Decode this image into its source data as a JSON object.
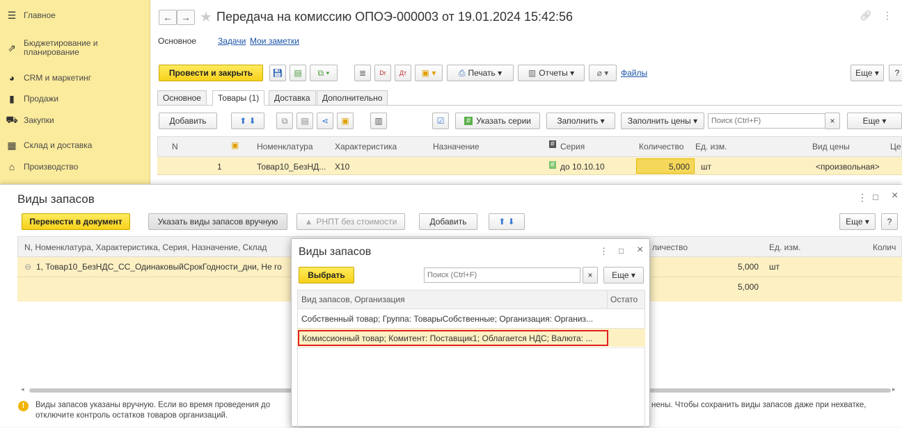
{
  "sidebar": {
    "items": [
      {
        "icon": "menu-lines-icon",
        "glyph": "☰",
        "label": "Главное"
      },
      {
        "icon": "budget-icon",
        "glyph": "⇗",
        "label": "Бюджетирование и планирование"
      },
      {
        "icon": "crm-pie-icon",
        "glyph": "◕",
        "label": "CRM и маркетинг"
      },
      {
        "icon": "sales-bag-icon",
        "glyph": "▮",
        "label": "Продажи"
      },
      {
        "icon": "cart-icon",
        "glyph": "⛟",
        "label": "Закупки"
      },
      {
        "icon": "warehouse-icon",
        "glyph": "▦",
        "label": "Склад и доставка"
      },
      {
        "icon": "factory-icon",
        "glyph": "⌂",
        "label": "Производство"
      }
    ]
  },
  "document": {
    "title": "Передача на комиссию ОПОЭ-000003 от 19.01.2024 15:42:56",
    "top_links": {
      "main": "Основное",
      "tasks": "Задачи",
      "notes": "Мои заметки"
    },
    "toolbar": {
      "post_close": "Провести и закрыть",
      "print": "Печать",
      "reports": "Отчеты",
      "files": "Файлы",
      "more": "Еще",
      "help": "?"
    },
    "tabs": [
      "Основное",
      "Товары (1)",
      "Доставка",
      "Дополнительно"
    ],
    "goods_toolbar": {
      "add": "Добавить",
      "set_series": "Указать серии",
      "fill": "Заполнить",
      "fill_prices": "Заполнить цены",
      "search_placeholder": "Поиск (Ctrl+F)",
      "clear": "×",
      "more": "Еще"
    },
    "table": {
      "columns": [
        "N",
        "Номенклатура",
        "Характеристика",
        "Назначение",
        "Серия",
        "Количество",
        "Ед. изм.",
        "Вид цены",
        "Це"
      ],
      "row": {
        "n": "1",
        "item": "Товар10_БезНД...",
        "characteristic": "X10",
        "series": "до 10.10.10",
        "qty": "5,000",
        "unit": "шт",
        "price_type": "<произвольная>"
      }
    }
  },
  "dialog1": {
    "title": "Виды запасов",
    "transfer": "Перенести в документ",
    "set_manual": "Указать виды запасов вручную",
    "rnpt": "РНПТ без стоимости",
    "add": "Добавить",
    "more": "Еще",
    "help": "?",
    "columns": {
      "main": "N, Номенклатура, Характеристика, Серия, Назначение, Склад",
      "qty": "личество",
      "unit": "Ед. изм.",
      "qty2": "Колич"
    },
    "row1": {
      "text": "1, Товар10_БезНДС_СС_ОдинаковыйСрокГодности_дни, Не го",
      "qty": "5,000",
      "unit": "шт"
    },
    "row2": {
      "qty": "5,000"
    },
    "footer_left": "Виды запасов указаны вручную. Если во время проведения до",
    "footer_left2": "отключите контроль остатков товаров организаций.",
    "footer_right": "нены. Чтобы сохранить виды запасов даже при нехватке,"
  },
  "dialog2": {
    "title": "Виды запасов",
    "select": "Выбрать",
    "search_placeholder": "Поиск (Ctrl+F)",
    "clear": "×",
    "more": "Еще",
    "col_main": "Вид запасов, Организация",
    "col_rest": "Остато",
    "rows": [
      "Собственный товар; Группа: ТоварыСобственные; Организация: Организ...",
      "Комиссионный товар; Комитент: Поставщик1; Облагается НДС; Валюта: ..."
    ]
  },
  "colors": {
    "accent_yellow": "#f7d11b",
    "sidebar_bg": "#fbeb9c",
    "selected_row": "#fdf0c3",
    "highlight_border": "#e02020",
    "link": "#1a53a8"
  }
}
